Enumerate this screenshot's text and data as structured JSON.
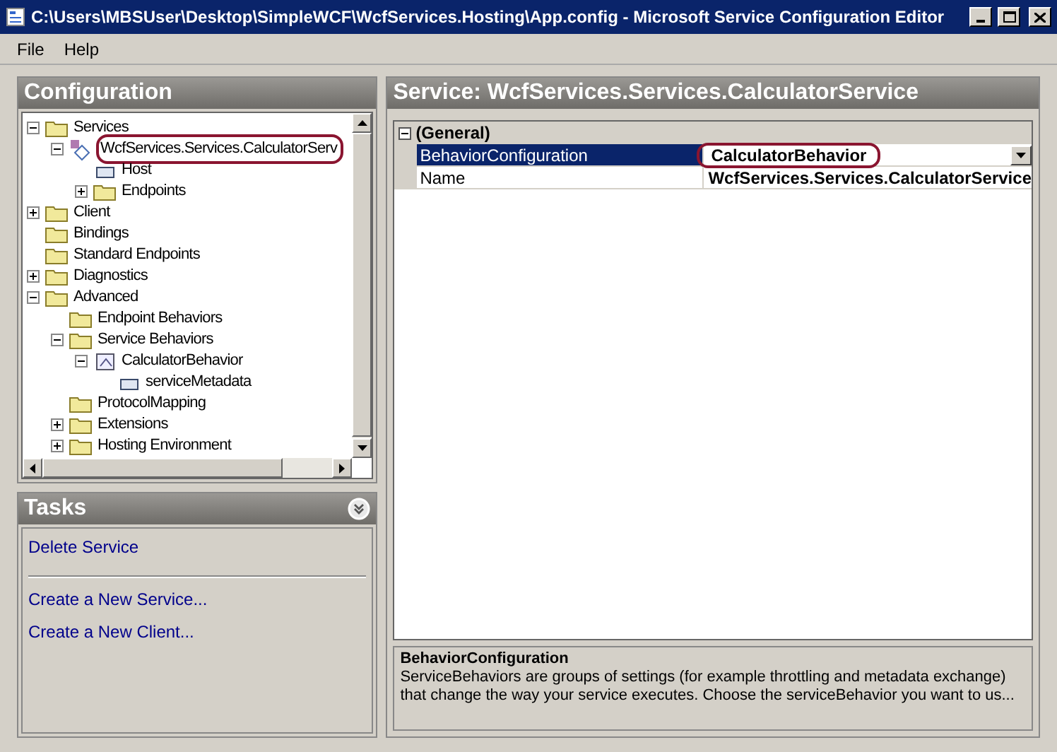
{
  "window": {
    "title": "C:\\Users\\MBSUser\\Desktop\\SimpleWCF\\WcfServices.Hosting\\App.config - Microsoft Service Configuration Editor"
  },
  "menu": [
    "File",
    "Help"
  ],
  "configuration": {
    "title": "Configuration",
    "tree": [
      {
        "label": "Services",
        "kind": "folder",
        "expanded": true,
        "children": [
          {
            "label": "WcfServices.Services.CalculatorServ",
            "kind": "service",
            "expanded": true,
            "circled": true,
            "children": [
              {
                "label": "Host",
                "kind": "leaf"
              },
              {
                "label": "Endpoints",
                "kind": "folder",
                "expanded": false
              }
            ]
          }
        ]
      },
      {
        "label": "Client",
        "kind": "folder",
        "expanded": false
      },
      {
        "label": "Bindings",
        "kind": "folder"
      },
      {
        "label": "Standard Endpoints",
        "kind": "folder"
      },
      {
        "label": "Diagnostics",
        "kind": "folder",
        "expanded": false
      },
      {
        "label": "Advanced",
        "kind": "folder",
        "expanded": true,
        "children": [
          {
            "label": "Endpoint Behaviors",
            "kind": "folder"
          },
          {
            "label": "Service Behaviors",
            "kind": "folder",
            "expanded": true,
            "children": [
              {
                "label": "CalculatorBehavior",
                "kind": "behavior",
                "expanded": true,
                "children": [
                  {
                    "label": "serviceMetadata",
                    "kind": "leaf"
                  }
                ]
              }
            ]
          },
          {
            "label": "ProtocolMapping",
            "kind": "folder"
          },
          {
            "label": "Extensions",
            "kind": "folder",
            "expanded": false
          },
          {
            "label": "Hosting Environment",
            "kind": "folder",
            "expanded": false
          }
        ]
      }
    ]
  },
  "tasks": {
    "title": "Tasks",
    "groups": [
      [
        "Delete Service"
      ],
      [
        "Create a New Service...",
        "Create a New Client..."
      ]
    ]
  },
  "service": {
    "title": "Service: WcfServices.Services.CalculatorService",
    "category": {
      "label": "(General)",
      "expanded": true
    },
    "properties": [
      {
        "name": "BehaviorConfiguration",
        "value": "CalculatorBehavior",
        "selected": true,
        "dropdown": true,
        "circled": true
      },
      {
        "name": "Name",
        "value": "WcfServices.Services.CalculatorService",
        "selected": false
      }
    ],
    "description": {
      "title": "BehaviorConfiguration",
      "text": "ServiceBehaviors are groups of settings (for example throttling and metadata exchange) that change the way your service executes. Choose the serviceBehavior you want to us..."
    }
  }
}
